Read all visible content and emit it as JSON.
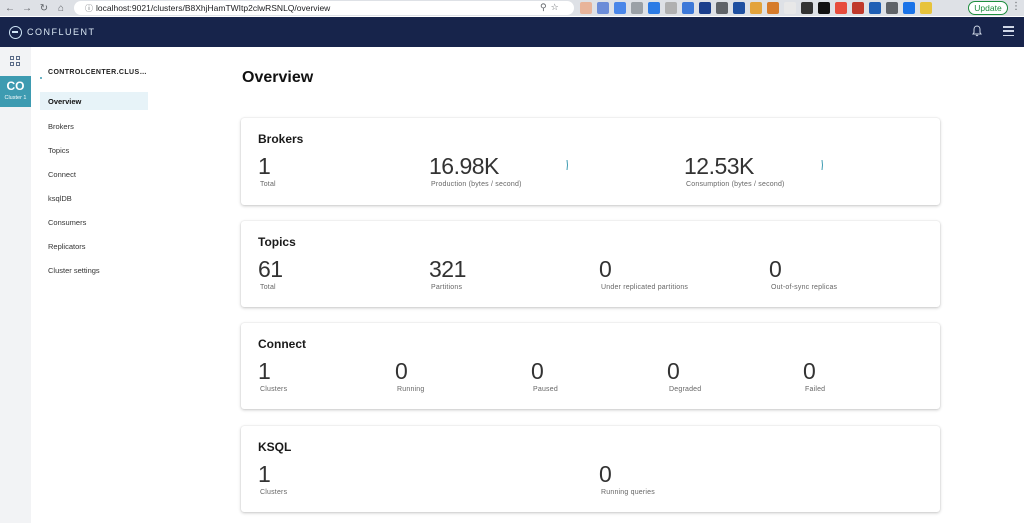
{
  "browser": {
    "url": "localhost:9021/clusters/B8XhjHamTWItp2clwRSNLQ/overview",
    "update_label": "Update"
  },
  "header": {
    "brand": "CONFLUENT"
  },
  "rail": {
    "cluster_abbr": "CO",
    "cluster_name": "Cluster 1"
  },
  "sidebar": {
    "title": "CONTROLCENTER.CLUS…",
    "items": [
      {
        "label": "Overview",
        "active": true
      },
      {
        "label": "Brokers"
      },
      {
        "label": "Topics"
      },
      {
        "label": "Connect"
      },
      {
        "label": "ksqlDB"
      },
      {
        "label": "Consumers"
      },
      {
        "label": "Replicators"
      },
      {
        "label": "Cluster settings"
      }
    ]
  },
  "main": {
    "title": "Overview",
    "brokers": {
      "title": "Brokers",
      "total": {
        "value": "1",
        "label": "Total"
      },
      "production": {
        "value": "16.98K",
        "label": "Production (bytes / second)"
      },
      "consumption": {
        "value": "12.53K",
        "label": "Consumption (bytes / second)"
      }
    },
    "topics": {
      "title": "Topics",
      "total": {
        "value": "61",
        "label": "Total"
      },
      "partitions": {
        "value": "321",
        "label": "Partitions"
      },
      "under_replicated": {
        "value": "0",
        "label": "Under replicated partitions"
      },
      "out_of_sync": {
        "value": "0",
        "label": "Out-of-sync replicas"
      }
    },
    "connect": {
      "title": "Connect",
      "clusters": {
        "value": "1",
        "label": "Clusters"
      },
      "running": {
        "value": "0",
        "label": "Running"
      },
      "paused": {
        "value": "0",
        "label": "Paused"
      },
      "degraded": {
        "value": "0",
        "label": "Degraded"
      },
      "failed": {
        "value": "0",
        "label": "Failed"
      }
    },
    "ksql": {
      "title": "KSQL",
      "clusters": {
        "value": "1",
        "label": "Clusters"
      },
      "running_queries": {
        "value": "0",
        "label": "Running queries"
      }
    }
  },
  "colors": {
    "header_bg": "#17244b",
    "accent": "#3e9bb1",
    "active_item_bg": "#e7f3f8"
  }
}
